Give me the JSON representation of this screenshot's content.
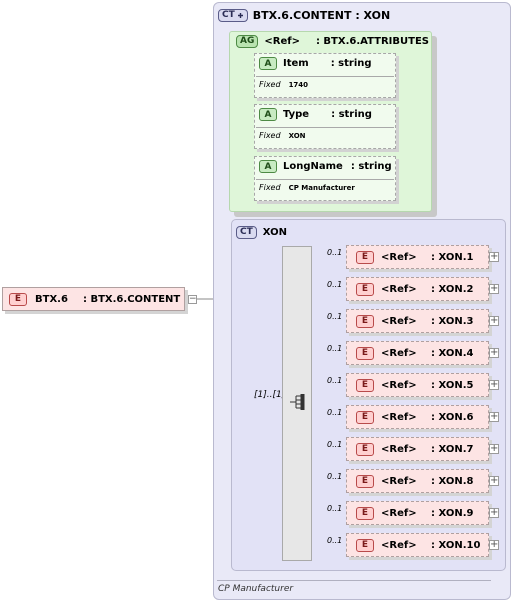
{
  "root": {
    "badge": "E",
    "name": "BTX.6",
    "type_sep": ":",
    "type": "BTX.6.CONTENT",
    "collapse": "−"
  },
  "content": {
    "badge": "CT",
    "title": "BTX.6.CONTENT : XON",
    "footer": "CP Manufacturer"
  },
  "attribute_group": {
    "badge": "AG",
    "ref": "<Ref>",
    "type": ": BTX.6.ATTRIBUTES",
    "attributes": [
      {
        "badge": "A",
        "name": "Item",
        "type": ": string",
        "fixed_label": "Fixed",
        "fixed_value": "1740"
      },
      {
        "badge": "A",
        "name": "Type",
        "type": ": string",
        "fixed_label": "Fixed",
        "fixed_value": "XON"
      },
      {
        "badge": "A",
        "name": "LongName",
        "type": ": string",
        "fixed_label": "Fixed",
        "fixed_value": "CP Manufacturer"
      }
    ]
  },
  "xon": {
    "badge": "CT",
    "title": "XON",
    "sequence_multiplicity": "[1]..[1]",
    "elements": [
      {
        "multiplicity": "0..1",
        "badge": "E",
        "ref": "<Ref>",
        "type": ": XON.1",
        "expand": "+"
      },
      {
        "multiplicity": "0..1",
        "badge": "E",
        "ref": "<Ref>",
        "type": ": XON.2",
        "expand": "+"
      },
      {
        "multiplicity": "0..1",
        "badge": "E",
        "ref": "<Ref>",
        "type": ": XON.3",
        "expand": "+"
      },
      {
        "multiplicity": "0..1",
        "badge": "E",
        "ref": "<Ref>",
        "type": ": XON.4",
        "expand": "+"
      },
      {
        "multiplicity": "0..1",
        "badge": "E",
        "ref": "<Ref>",
        "type": ": XON.5",
        "expand": "+"
      },
      {
        "multiplicity": "0..1",
        "badge": "E",
        "ref": "<Ref>",
        "type": ": XON.6",
        "expand": "+"
      },
      {
        "multiplicity": "0..1",
        "badge": "E",
        "ref": "<Ref>",
        "type": ": XON.7",
        "expand": "+"
      },
      {
        "multiplicity": "0..1",
        "badge": "E",
        "ref": "<Ref>",
        "type": ": XON.8",
        "expand": "+"
      },
      {
        "multiplicity": "0..1",
        "badge": "E",
        "ref": "<Ref>",
        "type": ": XON.9",
        "expand": "+"
      },
      {
        "multiplicity": "0..1",
        "badge": "E",
        "ref": "<Ref>",
        "type": ": XON.10",
        "expand": "+"
      }
    ]
  },
  "colors": {
    "element_fill": "#fde4e4",
    "attribute_fill": "#dff6d9",
    "complex_fill": "#e2e2f6"
  },
  "icons": {
    "sequence": "sequence-compositor-icon",
    "expand": "expand-plus-icon",
    "collapse": "collapse-minus-icon"
  }
}
